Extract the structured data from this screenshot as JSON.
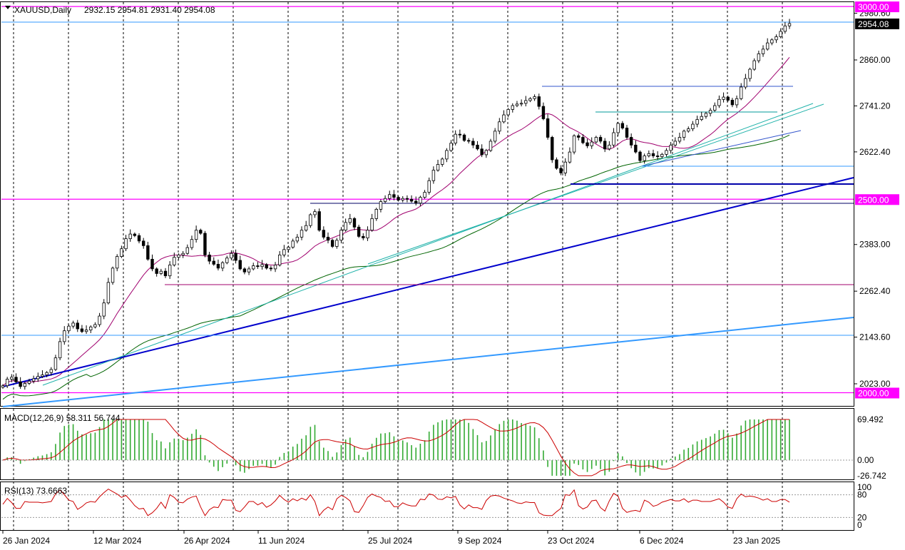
{
  "chart_data": [
    {
      "type": "candlestick",
      "symbol": "XAUUSD,Daily",
      "ohlc_readout": "2932.15 2954.81 2931.40 2954.08",
      "last_price": "2954.08",
      "ylim": [
        1960,
        3005
      ],
      "y_ticks": [
        "2980.60",
        "2860.00",
        "2741.20",
        "2622.40",
        "2383.00",
        "2262.40",
        "2143.60",
        "2023.00"
      ],
      "price_tags": [
        {
          "label": "3000.00",
          "value": 3000,
          "color": "#ff00ff"
        },
        {
          "label": "2500.00",
          "value": 2500,
          "color": "#ff00ff"
        },
        {
          "label": "2000.00",
          "value": 2000,
          "color": "#ff00ff"
        }
      ],
      "x_labels": [
        "26 Jan 2024",
        "12 Mar 2024",
        "26 Apr 2024",
        "11 Jun 2024",
        "25 Jul 2024",
        "9 Sep 2024",
        "23 Oct 2024",
        "6 Dec 2024",
        "23 Jan 2025"
      ],
      "closes": [
        2018,
        2035,
        2040,
        2028,
        2016,
        2024,
        2030,
        2036,
        2042,
        2046,
        2052,
        2060,
        2090,
        2132,
        2160,
        2172,
        2180,
        2165,
        2158,
        2162,
        2170,
        2176,
        2198,
        2232,
        2285,
        2322,
        2352,
        2372,
        2398,
        2410,
        2406,
        2392,
        2380,
        2345,
        2320,
        2308,
        2314,
        2302,
        2330,
        2350,
        2356,
        2360,
        2375,
        2396,
        2420,
        2412,
        2356,
        2340,
        2332,
        2322,
        2336,
        2348,
        2360,
        2342,
        2320,
        2312,
        2320,
        2328,
        2326,
        2331,
        2322,
        2320,
        2330,
        2356,
        2370,
        2376,
        2392,
        2402,
        2420,
        2432,
        2460,
        2468,
        2420,
        2402,
        2394,
        2378,
        2394,
        2420,
        2440,
        2450,
        2428,
        2404,
        2400,
        2420,
        2450,
        2474,
        2494,
        2502,
        2512,
        2505,
        2498,
        2502,
        2500,
        2495,
        2490,
        2505,
        2518,
        2548,
        2575,
        2590,
        2604,
        2626,
        2645,
        2668,
        2666,
        2652,
        2650,
        2640,
        2630,
        2615,
        2626,
        2650,
        2676,
        2700,
        2718,
        2732,
        2742,
        2746,
        2748,
        2755,
        2760,
        2765,
        2740,
        2708,
        2660,
        2602,
        2580,
        2568,
        2596,
        2622,
        2664,
        2660,
        2646,
        2638,
        2648,
        2660,
        2650,
        2630,
        2640,
        2672,
        2696,
        2684,
        2660,
        2640,
        2622,
        2600,
        2612,
        2618,
        2612,
        2610,
        2616,
        2626,
        2640,
        2650,
        2660,
        2676,
        2682,
        2694,
        2706,
        2714,
        2722,
        2730,
        2742,
        2758,
        2764,
        2756,
        2744,
        2760,
        2790,
        2812,
        2836,
        2858,
        2876,
        2888,
        2904,
        2912,
        2920,
        2934,
        2948,
        2954.08
      ],
      "horizontal_levels": [
        3000,
        2500,
        2000
      ],
      "indicator_lines": [
        "SMA 50",
        "SMA 200",
        "trendlines",
        "support/resistance"
      ]
    },
    {
      "type": "bar+line",
      "label": "MACD(12,26,9) 58.311 56.744",
      "ylim": [
        -26.742,
        69.492
      ],
      "y_ticks": [
        "69.492",
        "0.00",
        "-26.742"
      ]
    },
    {
      "type": "line",
      "label": "RSI(13) 73.6663",
      "ylim": [
        0,
        100
      ],
      "levels": [
        80,
        20
      ],
      "y_ticks": [
        "80",
        "100",
        "20",
        "0"
      ]
    }
  ]
}
